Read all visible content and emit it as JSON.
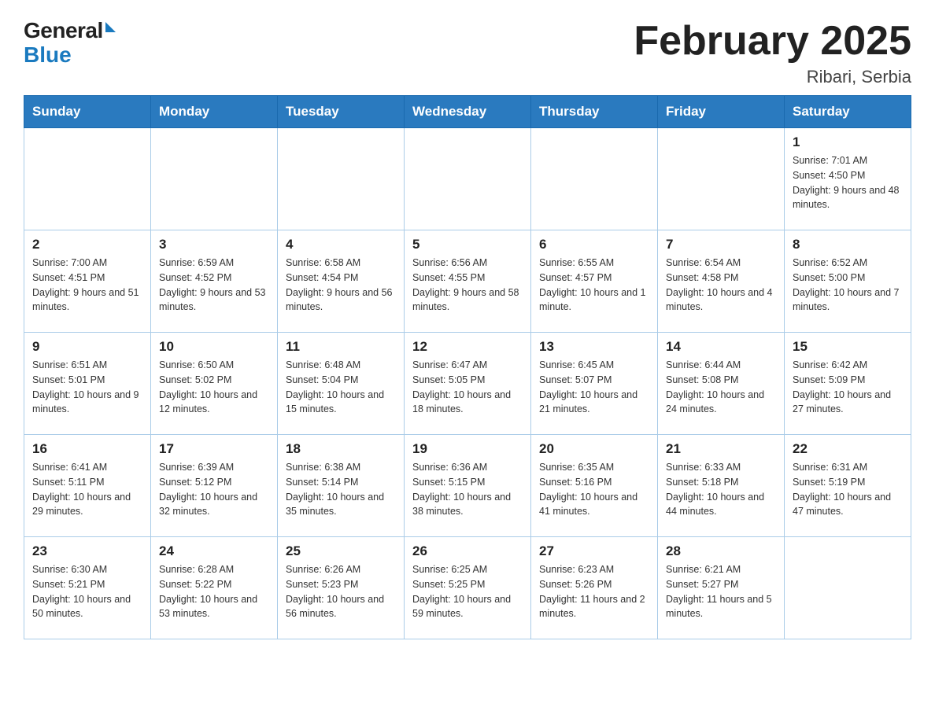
{
  "header": {
    "logo_general": "General",
    "logo_blue": "Blue",
    "title": "February 2025",
    "subtitle": "Ribari, Serbia"
  },
  "weekdays": [
    "Sunday",
    "Monday",
    "Tuesday",
    "Wednesday",
    "Thursday",
    "Friday",
    "Saturday"
  ],
  "weeks": [
    [
      {
        "day": "",
        "sunrise": "",
        "sunset": "",
        "daylight": ""
      },
      {
        "day": "",
        "sunrise": "",
        "sunset": "",
        "daylight": ""
      },
      {
        "day": "",
        "sunrise": "",
        "sunset": "",
        "daylight": ""
      },
      {
        "day": "",
        "sunrise": "",
        "sunset": "",
        "daylight": ""
      },
      {
        "day": "",
        "sunrise": "",
        "sunset": "",
        "daylight": ""
      },
      {
        "day": "",
        "sunrise": "",
        "sunset": "",
        "daylight": ""
      },
      {
        "day": "1",
        "sunrise": "Sunrise: 7:01 AM",
        "sunset": "Sunset: 4:50 PM",
        "daylight": "Daylight: 9 hours and 48 minutes."
      }
    ],
    [
      {
        "day": "2",
        "sunrise": "Sunrise: 7:00 AM",
        "sunset": "Sunset: 4:51 PM",
        "daylight": "Daylight: 9 hours and 51 minutes."
      },
      {
        "day": "3",
        "sunrise": "Sunrise: 6:59 AM",
        "sunset": "Sunset: 4:52 PM",
        "daylight": "Daylight: 9 hours and 53 minutes."
      },
      {
        "day": "4",
        "sunrise": "Sunrise: 6:58 AM",
        "sunset": "Sunset: 4:54 PM",
        "daylight": "Daylight: 9 hours and 56 minutes."
      },
      {
        "day": "5",
        "sunrise": "Sunrise: 6:56 AM",
        "sunset": "Sunset: 4:55 PM",
        "daylight": "Daylight: 9 hours and 58 minutes."
      },
      {
        "day": "6",
        "sunrise": "Sunrise: 6:55 AM",
        "sunset": "Sunset: 4:57 PM",
        "daylight": "Daylight: 10 hours and 1 minute."
      },
      {
        "day": "7",
        "sunrise": "Sunrise: 6:54 AM",
        "sunset": "Sunset: 4:58 PM",
        "daylight": "Daylight: 10 hours and 4 minutes."
      },
      {
        "day": "8",
        "sunrise": "Sunrise: 6:52 AM",
        "sunset": "Sunset: 5:00 PM",
        "daylight": "Daylight: 10 hours and 7 minutes."
      }
    ],
    [
      {
        "day": "9",
        "sunrise": "Sunrise: 6:51 AM",
        "sunset": "Sunset: 5:01 PM",
        "daylight": "Daylight: 10 hours and 9 minutes."
      },
      {
        "day": "10",
        "sunrise": "Sunrise: 6:50 AM",
        "sunset": "Sunset: 5:02 PM",
        "daylight": "Daylight: 10 hours and 12 minutes."
      },
      {
        "day": "11",
        "sunrise": "Sunrise: 6:48 AM",
        "sunset": "Sunset: 5:04 PM",
        "daylight": "Daylight: 10 hours and 15 minutes."
      },
      {
        "day": "12",
        "sunrise": "Sunrise: 6:47 AM",
        "sunset": "Sunset: 5:05 PM",
        "daylight": "Daylight: 10 hours and 18 minutes."
      },
      {
        "day": "13",
        "sunrise": "Sunrise: 6:45 AM",
        "sunset": "Sunset: 5:07 PM",
        "daylight": "Daylight: 10 hours and 21 minutes."
      },
      {
        "day": "14",
        "sunrise": "Sunrise: 6:44 AM",
        "sunset": "Sunset: 5:08 PM",
        "daylight": "Daylight: 10 hours and 24 minutes."
      },
      {
        "day": "15",
        "sunrise": "Sunrise: 6:42 AM",
        "sunset": "Sunset: 5:09 PM",
        "daylight": "Daylight: 10 hours and 27 minutes."
      }
    ],
    [
      {
        "day": "16",
        "sunrise": "Sunrise: 6:41 AM",
        "sunset": "Sunset: 5:11 PM",
        "daylight": "Daylight: 10 hours and 29 minutes."
      },
      {
        "day": "17",
        "sunrise": "Sunrise: 6:39 AM",
        "sunset": "Sunset: 5:12 PM",
        "daylight": "Daylight: 10 hours and 32 minutes."
      },
      {
        "day": "18",
        "sunrise": "Sunrise: 6:38 AM",
        "sunset": "Sunset: 5:14 PM",
        "daylight": "Daylight: 10 hours and 35 minutes."
      },
      {
        "day": "19",
        "sunrise": "Sunrise: 6:36 AM",
        "sunset": "Sunset: 5:15 PM",
        "daylight": "Daylight: 10 hours and 38 minutes."
      },
      {
        "day": "20",
        "sunrise": "Sunrise: 6:35 AM",
        "sunset": "Sunset: 5:16 PM",
        "daylight": "Daylight: 10 hours and 41 minutes."
      },
      {
        "day": "21",
        "sunrise": "Sunrise: 6:33 AM",
        "sunset": "Sunset: 5:18 PM",
        "daylight": "Daylight: 10 hours and 44 minutes."
      },
      {
        "day": "22",
        "sunrise": "Sunrise: 6:31 AM",
        "sunset": "Sunset: 5:19 PM",
        "daylight": "Daylight: 10 hours and 47 minutes."
      }
    ],
    [
      {
        "day": "23",
        "sunrise": "Sunrise: 6:30 AM",
        "sunset": "Sunset: 5:21 PM",
        "daylight": "Daylight: 10 hours and 50 minutes."
      },
      {
        "day": "24",
        "sunrise": "Sunrise: 6:28 AM",
        "sunset": "Sunset: 5:22 PM",
        "daylight": "Daylight: 10 hours and 53 minutes."
      },
      {
        "day": "25",
        "sunrise": "Sunrise: 6:26 AM",
        "sunset": "Sunset: 5:23 PM",
        "daylight": "Daylight: 10 hours and 56 minutes."
      },
      {
        "day": "26",
        "sunrise": "Sunrise: 6:25 AM",
        "sunset": "Sunset: 5:25 PM",
        "daylight": "Daylight: 10 hours and 59 minutes."
      },
      {
        "day": "27",
        "sunrise": "Sunrise: 6:23 AM",
        "sunset": "Sunset: 5:26 PM",
        "daylight": "Daylight: 11 hours and 2 minutes."
      },
      {
        "day": "28",
        "sunrise": "Sunrise: 6:21 AM",
        "sunset": "Sunset: 5:27 PM",
        "daylight": "Daylight: 11 hours and 5 minutes."
      },
      {
        "day": "",
        "sunrise": "",
        "sunset": "",
        "daylight": ""
      }
    ]
  ]
}
